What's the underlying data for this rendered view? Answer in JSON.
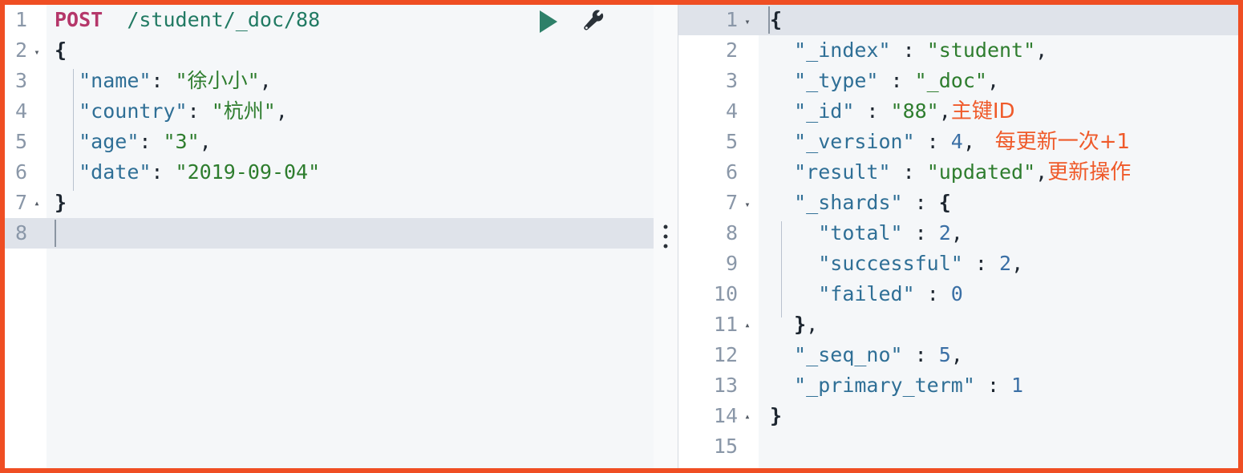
{
  "theme": {
    "border_color": "#ef4e23",
    "editor_bg": "#f5f7f9",
    "gutter_bg": "#ffffff",
    "active_line_bg": "#dfe3ea",
    "method_color": "#b5376a",
    "url_color": "#217a63",
    "key_color": "#2f6f96",
    "string_color": "#2e7d2e",
    "number_color": "#3a6fa5",
    "annotation_color": "#ef5a2a",
    "play_color": "#2e8069"
  },
  "toolbar": {
    "play_label": "play",
    "wrench_label": "wrench"
  },
  "splitter": {
    "handle_label": "drag-handle"
  },
  "request_editor": {
    "name": "request-editor",
    "active_line": 8,
    "cursor_line": 8,
    "lines": [
      {
        "n": "1",
        "fold": "",
        "segments": [
          {
            "t": "POST",
            "c": "tok-method"
          },
          {
            "t": "  ",
            "c": "tok-punc"
          },
          {
            "t": "/student/_doc/88",
            "c": "tok-url"
          }
        ]
      },
      {
        "n": "2",
        "fold": "down",
        "segments": [
          {
            "t": "{",
            "c": "tok-brace"
          }
        ]
      },
      {
        "n": "3",
        "fold": "",
        "segments": [
          {
            "t": "  ",
            "c": "tok-punc"
          },
          {
            "t": "\"name\"",
            "c": "tok-key"
          },
          {
            "t": ": ",
            "c": "tok-punc"
          },
          {
            "t": "\"徐小小\"",
            "c": "tok-str"
          },
          {
            "t": ",",
            "c": "tok-punc"
          }
        ]
      },
      {
        "n": "4",
        "fold": "",
        "segments": [
          {
            "t": "  ",
            "c": "tok-punc"
          },
          {
            "t": "\"country\"",
            "c": "tok-key"
          },
          {
            "t": ": ",
            "c": "tok-punc"
          },
          {
            "t": "\"杭州\"",
            "c": "tok-str"
          },
          {
            "t": ",",
            "c": "tok-punc"
          }
        ]
      },
      {
        "n": "5",
        "fold": "",
        "segments": [
          {
            "t": "  ",
            "c": "tok-punc"
          },
          {
            "t": "\"age\"",
            "c": "tok-key"
          },
          {
            "t": ": ",
            "c": "tok-punc"
          },
          {
            "t": "\"3\"",
            "c": "tok-str"
          },
          {
            "t": ",",
            "c": "tok-punc"
          }
        ]
      },
      {
        "n": "6",
        "fold": "",
        "segments": [
          {
            "t": "  ",
            "c": "tok-punc"
          },
          {
            "t": "\"date\"",
            "c": "tok-key"
          },
          {
            "t": ": ",
            "c": "tok-punc"
          },
          {
            "t": "\"2019-09-04\"",
            "c": "tok-str"
          }
        ]
      },
      {
        "n": "7",
        "fold": "up",
        "segments": [
          {
            "t": "}",
            "c": "tok-brace"
          }
        ]
      },
      {
        "n": "8",
        "fold": "",
        "segments": []
      }
    ]
  },
  "response_editor": {
    "name": "response-editor",
    "active_line": 1,
    "cursor_line": 1,
    "lines": [
      {
        "n": "1",
        "fold": "down",
        "segments": [
          {
            "t": "{",
            "c": "tok-brace"
          }
        ]
      },
      {
        "n": "2",
        "fold": "",
        "segments": [
          {
            "t": "  ",
            "c": "tok-punc"
          },
          {
            "t": "\"_index\"",
            "c": "tok-key"
          },
          {
            "t": " : ",
            "c": "tok-punc"
          },
          {
            "t": "\"student\"",
            "c": "tok-str"
          },
          {
            "t": ",",
            "c": "tok-punc"
          }
        ]
      },
      {
        "n": "3",
        "fold": "",
        "segments": [
          {
            "t": "  ",
            "c": "tok-punc"
          },
          {
            "t": "\"_type\"",
            "c": "tok-key"
          },
          {
            "t": " : ",
            "c": "tok-punc"
          },
          {
            "t": "\"_doc\"",
            "c": "tok-str"
          },
          {
            "t": ",",
            "c": "tok-punc"
          }
        ]
      },
      {
        "n": "4",
        "fold": "",
        "segments": [
          {
            "t": "  ",
            "c": "tok-punc"
          },
          {
            "t": "\"_id\"",
            "c": "tok-key"
          },
          {
            "t": " : ",
            "c": "tok-punc"
          },
          {
            "t": "\"88\"",
            "c": "tok-str"
          },
          {
            "t": ",",
            "c": "tok-punc"
          },
          {
            "t": "主键ID",
            "c": "tok-ann"
          }
        ]
      },
      {
        "n": "5",
        "fold": "",
        "segments": [
          {
            "t": "  ",
            "c": "tok-punc"
          },
          {
            "t": "\"_version\"",
            "c": "tok-key"
          },
          {
            "t": " : ",
            "c": "tok-punc"
          },
          {
            "t": "4",
            "c": "tok-num"
          },
          {
            "t": ",",
            "c": "tok-punc"
          },
          {
            "t": "   每更新一次+1",
            "c": "tok-ann"
          }
        ]
      },
      {
        "n": "6",
        "fold": "",
        "segments": [
          {
            "t": "  ",
            "c": "tok-punc"
          },
          {
            "t": "\"result\"",
            "c": "tok-key"
          },
          {
            "t": " : ",
            "c": "tok-punc"
          },
          {
            "t": "\"updated\"",
            "c": "tok-str"
          },
          {
            "t": ",",
            "c": "tok-punc"
          },
          {
            "t": "更新操作",
            "c": "tok-ann"
          }
        ]
      },
      {
        "n": "7",
        "fold": "down",
        "segments": [
          {
            "t": "  ",
            "c": "tok-punc"
          },
          {
            "t": "\"_shards\"",
            "c": "tok-key"
          },
          {
            "t": " : ",
            "c": "tok-punc"
          },
          {
            "t": "{",
            "c": "tok-brace"
          }
        ]
      },
      {
        "n": "8",
        "fold": "",
        "segments": [
          {
            "t": "    ",
            "c": "tok-punc"
          },
          {
            "t": "\"total\"",
            "c": "tok-key"
          },
          {
            "t": " : ",
            "c": "tok-punc"
          },
          {
            "t": "2",
            "c": "tok-num"
          },
          {
            "t": ",",
            "c": "tok-punc"
          }
        ]
      },
      {
        "n": "9",
        "fold": "",
        "segments": [
          {
            "t": "    ",
            "c": "tok-punc"
          },
          {
            "t": "\"successful\"",
            "c": "tok-key"
          },
          {
            "t": " : ",
            "c": "tok-punc"
          },
          {
            "t": "2",
            "c": "tok-num"
          },
          {
            "t": ",",
            "c": "tok-punc"
          }
        ]
      },
      {
        "n": "10",
        "fold": "",
        "segments": [
          {
            "t": "    ",
            "c": "tok-punc"
          },
          {
            "t": "\"failed\"",
            "c": "tok-key"
          },
          {
            "t": " : ",
            "c": "tok-punc"
          },
          {
            "t": "0",
            "c": "tok-num"
          }
        ]
      },
      {
        "n": "11",
        "fold": "up",
        "segments": [
          {
            "t": "  ",
            "c": "tok-punc"
          },
          {
            "t": "}",
            "c": "tok-brace"
          },
          {
            "t": ",",
            "c": "tok-punc"
          }
        ]
      },
      {
        "n": "12",
        "fold": "",
        "segments": [
          {
            "t": "  ",
            "c": "tok-punc"
          },
          {
            "t": "\"_seq_no\"",
            "c": "tok-key"
          },
          {
            "t": " : ",
            "c": "tok-punc"
          },
          {
            "t": "5",
            "c": "tok-num"
          },
          {
            "t": ",",
            "c": "tok-punc"
          }
        ]
      },
      {
        "n": "13",
        "fold": "",
        "segments": [
          {
            "t": "  ",
            "c": "tok-punc"
          },
          {
            "t": "\"_primary_term\"",
            "c": "tok-key"
          },
          {
            "t": " : ",
            "c": "tok-punc"
          },
          {
            "t": "1",
            "c": "tok-num"
          }
        ]
      },
      {
        "n": "14",
        "fold": "up",
        "segments": [
          {
            "t": "}",
            "c": "tok-brace"
          }
        ]
      },
      {
        "n": "15",
        "fold": "",
        "segments": []
      }
    ]
  }
}
